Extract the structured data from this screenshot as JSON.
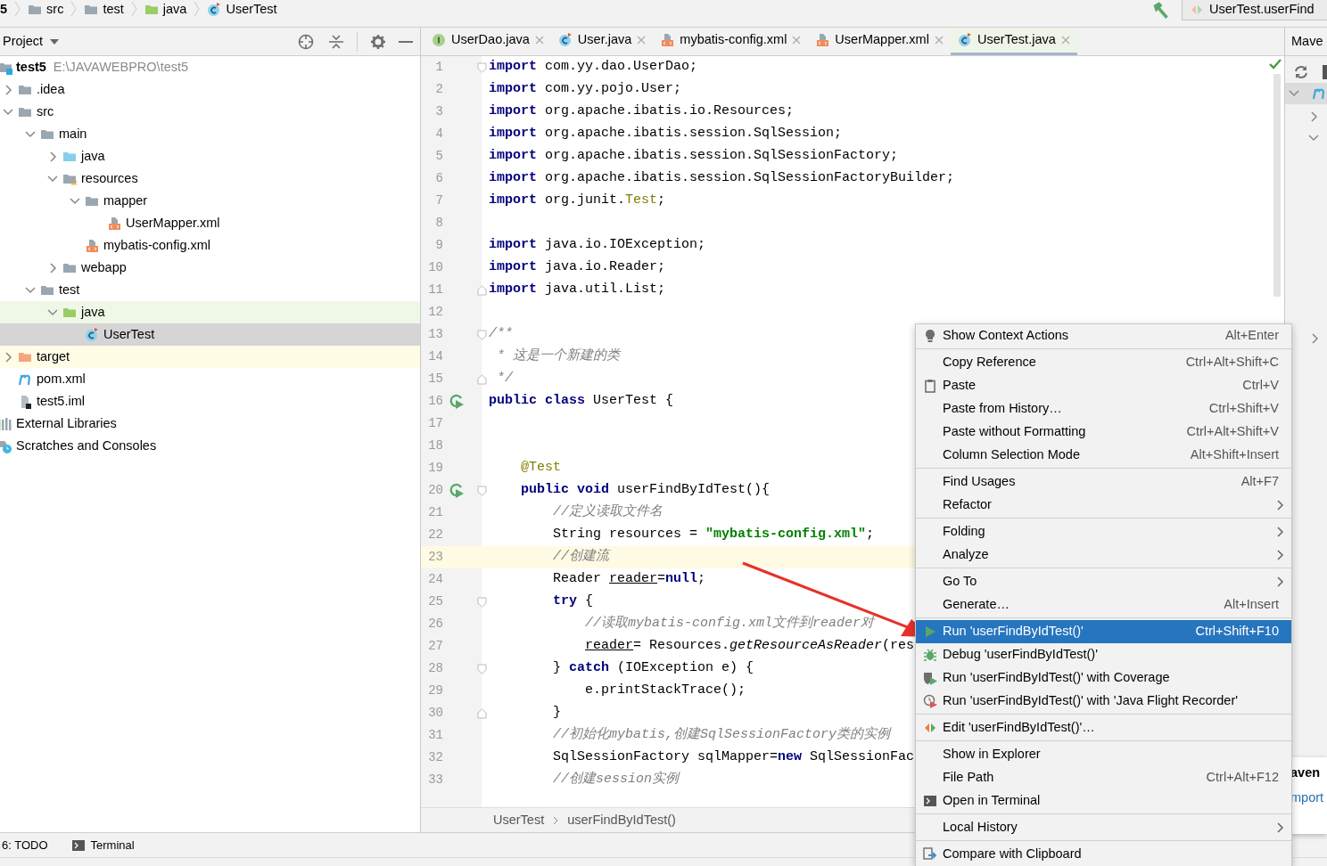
{
  "breadcrumb": [
    {
      "label": "5"
    },
    {
      "label": "src",
      "kind": "folder"
    },
    {
      "label": "test",
      "kind": "folder"
    },
    {
      "label": "java",
      "kind": "test-folder"
    },
    {
      "label": "UserTest",
      "kind": "class"
    }
  ],
  "run_config": {
    "label": "UserTest.userFind"
  },
  "project_panel": {
    "title": "Project",
    "tree": [
      {
        "label": "test5",
        "path": "E:\\JAVAWEBPRO\\test5",
        "kind": "module",
        "expanded": true,
        "selected": false,
        "children": [
          {
            "label": ".idea",
            "kind": "folder",
            "expanded": false,
            "selected": false
          },
          {
            "label": "src",
            "kind": "folder",
            "expanded": true,
            "selected": false,
            "children": [
              {
                "label": "main",
                "kind": "folder",
                "expanded": true,
                "selected": false,
                "children": [
                  {
                    "label": "java",
                    "kind": "src-folder",
                    "expanded": false,
                    "selected": false
                  },
                  {
                    "label": "resources",
                    "kind": "res-folder",
                    "expanded": true,
                    "selected": false,
                    "children": [
                      {
                        "label": "mapper",
                        "kind": "folder",
                        "expanded": true,
                        "selected": false,
                        "children": [
                          {
                            "label": "UserMapper.xml",
                            "kind": "xml",
                            "selected": false
                          }
                        ]
                      },
                      {
                        "label": "mybatis-config.xml",
                        "kind": "xml",
                        "selected": false
                      }
                    ]
                  },
                  {
                    "label": "webapp",
                    "kind": "folder",
                    "expanded": false,
                    "selected": false
                  }
                ]
              },
              {
                "label": "test",
                "kind": "folder",
                "expanded": true,
                "selected": false,
                "children": [
                  {
                    "label": "java",
                    "kind": "test-folder",
                    "expanded": true,
                    "selected": false,
                    "color": "#eff8e6",
                    "children": [
                      {
                        "label": "UserTest",
                        "kind": "class",
                        "selected": true
                      }
                    ]
                  }
                ]
              }
            ]
          },
          {
            "label": "target",
            "kind": "excluded-folder",
            "expanded": false,
            "selected": false,
            "color": "#fffde6"
          },
          {
            "label": "pom.xml",
            "kind": "maven",
            "selected": false
          },
          {
            "label": "test5.iml",
            "kind": "iml",
            "selected": false
          }
        ]
      },
      {
        "label": "External Libraries",
        "kind": "libs",
        "selected": false
      },
      {
        "label": "Scratches and Consoles",
        "kind": "scratch",
        "selected": false
      }
    ]
  },
  "tabs": [
    {
      "label": "UserDao.java",
      "kind": "interface",
      "selected": false
    },
    {
      "label": "User.java",
      "kind": "class",
      "selected": false
    },
    {
      "label": "mybatis-config.xml",
      "kind": "xml",
      "selected": false
    },
    {
      "label": "UserMapper.xml",
      "kind": "xml",
      "selected": false
    },
    {
      "label": "UserTest.java",
      "kind": "class",
      "selected": true
    }
  ],
  "editor": {
    "lines": [
      {
        "number": "1",
        "current": false,
        "run_marker": false,
        "fold_start": true,
        "fold_end": false,
        "tokens": [
          {
            "kind": "kw",
            "text": "import"
          },
          {
            "kind": "plain",
            "text": " com.yy.dao.UserDao;"
          }
        ]
      },
      {
        "number": "2",
        "current": false,
        "run_marker": false,
        "fold_start": false,
        "fold_end": false,
        "tokens": [
          {
            "kind": "kw",
            "text": "import"
          },
          {
            "kind": "plain",
            "text": " com.yy.pojo.User;"
          }
        ]
      },
      {
        "number": "3",
        "current": false,
        "run_marker": false,
        "fold_start": false,
        "fold_end": false,
        "tokens": [
          {
            "kind": "kw",
            "text": "import"
          },
          {
            "kind": "plain",
            "text": " org.apache.ibatis.io.Resources;"
          }
        ]
      },
      {
        "number": "4",
        "current": false,
        "run_marker": false,
        "fold_start": false,
        "fold_end": false,
        "tokens": [
          {
            "kind": "kw",
            "text": "import"
          },
          {
            "kind": "plain",
            "text": " org.apache.ibatis.session.SqlSession;"
          }
        ]
      },
      {
        "number": "5",
        "current": false,
        "run_marker": false,
        "fold_start": false,
        "fold_end": false,
        "tokens": [
          {
            "kind": "kw",
            "text": "import"
          },
          {
            "kind": "plain",
            "text": " org.apache.ibatis.session.SqlSessionFactory;"
          }
        ]
      },
      {
        "number": "6",
        "current": false,
        "run_marker": false,
        "fold_start": false,
        "fold_end": false,
        "tokens": [
          {
            "kind": "kw",
            "text": "import"
          },
          {
            "kind": "plain",
            "text": " org.apache.ibatis.session.SqlSessionFactoryBuilder;"
          }
        ]
      },
      {
        "number": "7",
        "current": false,
        "run_marker": false,
        "fold_start": false,
        "fold_end": false,
        "tokens": [
          {
            "kind": "kw",
            "text": "import"
          },
          {
            "kind": "plain",
            "text": " org.junit."
          },
          {
            "kind": "annot",
            "text": "Test"
          },
          {
            "kind": "plain",
            "text": ";"
          }
        ]
      },
      {
        "number": "8",
        "current": false,
        "run_marker": false,
        "fold_start": false,
        "fold_end": false
      },
      {
        "number": "9",
        "current": false,
        "run_marker": false,
        "fold_start": false,
        "fold_end": false,
        "tokens": [
          {
            "kind": "kw",
            "text": "import"
          },
          {
            "kind": "plain",
            "text": " java.io.IOException;"
          }
        ]
      },
      {
        "number": "10",
        "current": false,
        "run_marker": false,
        "fold_start": false,
        "fold_end": false,
        "tokens": [
          {
            "kind": "kw",
            "text": "import"
          },
          {
            "kind": "plain",
            "text": " java.io.Reader;"
          }
        ]
      },
      {
        "number": "11",
        "current": false,
        "run_marker": false,
        "fold_start": false,
        "fold_end": true,
        "tokens": [
          {
            "kind": "kw",
            "text": "import"
          },
          {
            "kind": "plain",
            "text": " java.util.List;"
          }
        ]
      },
      {
        "number": "12",
        "current": false,
        "run_marker": false,
        "fold_start": false,
        "fold_end": false
      },
      {
        "number": "13",
        "current": false,
        "run_marker": false,
        "fold_start": true,
        "fold_end": false,
        "tokens": [
          {
            "kind": "comment",
            "text": "/**"
          }
        ]
      },
      {
        "number": "14",
        "current": false,
        "run_marker": false,
        "fold_start": false,
        "fold_end": false,
        "tokens": [
          {
            "kind": "comment",
            "text": " * 这是一个新建的类"
          }
        ]
      },
      {
        "number": "15",
        "current": false,
        "run_marker": false,
        "fold_start": false,
        "fold_end": true,
        "tokens": [
          {
            "kind": "comment",
            "text": " */"
          }
        ]
      },
      {
        "number": "16",
        "current": false,
        "run_marker": true,
        "fold_start": false,
        "fold_end": false,
        "tokens": [
          {
            "kind": "kw",
            "text": "public class"
          },
          {
            "kind": "plain",
            "text": " UserTest {"
          }
        ]
      },
      {
        "number": "17",
        "current": false,
        "run_marker": false,
        "fold_start": false,
        "fold_end": false
      },
      {
        "number": "18",
        "current": false,
        "run_marker": false,
        "fold_start": false,
        "fold_end": false
      },
      {
        "number": "19",
        "current": false,
        "run_marker": false,
        "fold_start": false,
        "fold_end": false,
        "tokens": [
          {
            "kind": "annot",
            "text": "    @Test"
          }
        ]
      },
      {
        "number": "20",
        "current": false,
        "run_marker": true,
        "fold_start": true,
        "fold_end": false,
        "tokens": [
          {
            "kind": "kw",
            "text": "    public void"
          },
          {
            "kind": "plain",
            "text": " userFindByIdTest(){"
          }
        ]
      },
      {
        "number": "21",
        "current": false,
        "run_marker": false,
        "fold_start": false,
        "fold_end": false,
        "tokens": [
          {
            "kind": "comment",
            "text": "        //定义读取文件名"
          }
        ]
      },
      {
        "number": "22",
        "current": false,
        "run_marker": false,
        "fold_start": false,
        "fold_end": false,
        "tokens": [
          {
            "kind": "plain",
            "text": "        String resources = "
          },
          {
            "kind": "str",
            "text": "\"mybatis-config.xml\""
          },
          {
            "kind": "plain",
            "text": ";"
          }
        ]
      },
      {
        "number": "23",
        "current": true,
        "run_marker": false,
        "fold_start": false,
        "fold_end": false,
        "tokens": [
          {
            "kind": "comment",
            "text": "        //创建流"
          }
        ]
      },
      {
        "number": "24",
        "current": false,
        "run_marker": false,
        "fold_start": false,
        "fold_end": false,
        "tokens": [
          {
            "kind": "plain",
            "text": "        Reader "
          },
          {
            "kind": "var",
            "text": "reader"
          },
          {
            "kind": "plain",
            "text": "="
          },
          {
            "kind": "kw",
            "text": "null"
          },
          {
            "kind": "plain",
            "text": ";"
          }
        ]
      },
      {
        "number": "25",
        "current": false,
        "run_marker": false,
        "fold_start": true,
        "fold_end": false,
        "tokens": [
          {
            "kind": "kw",
            "text": "        try"
          },
          {
            "kind": "plain",
            "text": " {"
          }
        ]
      },
      {
        "number": "26",
        "current": false,
        "run_marker": false,
        "fold_start": false,
        "fold_end": false,
        "tokens": [
          {
            "kind": "comment",
            "text": "            //读取mybatis-config.xml文件到reader对"
          }
        ]
      },
      {
        "number": "27",
        "current": false,
        "run_marker": false,
        "fold_start": false,
        "fold_end": false,
        "tokens": [
          {
            "kind": "var",
            "text": "            reader"
          },
          {
            "kind": "plain",
            "text": "= Resources."
          },
          {
            "kind": "italic",
            "text": "getResourceAsReader"
          },
          {
            "kind": "plain",
            "text": "(res"
          }
        ]
      },
      {
        "number": "28",
        "current": false,
        "run_marker": false,
        "fold_start": true,
        "fold_end": false,
        "tokens": [
          {
            "kind": "plain",
            "text": "        } "
          },
          {
            "kind": "kw",
            "text": "catch"
          },
          {
            "kind": "plain",
            "text": " (IOException e) {"
          }
        ]
      },
      {
        "number": "29",
        "current": false,
        "run_marker": false,
        "fold_start": false,
        "fold_end": false,
        "tokens": [
          {
            "kind": "plain",
            "text": "            e.printStackTrace();"
          }
        ]
      },
      {
        "number": "30",
        "current": false,
        "run_marker": false,
        "fold_start": false,
        "fold_end": true,
        "tokens": [
          {
            "kind": "plain",
            "text": "        }"
          }
        ]
      },
      {
        "number": "31",
        "current": false,
        "run_marker": false,
        "fold_start": false,
        "fold_end": false,
        "tokens": [
          {
            "kind": "comment",
            "text": "        //初始化mybatis,创建SqlSessionFactory类的实例"
          }
        ]
      },
      {
        "number": "32",
        "current": false,
        "run_marker": false,
        "fold_start": false,
        "fold_end": false,
        "tokens": [
          {
            "kind": "plain",
            "text": "        SqlSessionFactory sqlMapper="
          },
          {
            "kind": "kw",
            "text": "new"
          },
          {
            "kind": "plain",
            "text": " SqlSessionFac"
          }
        ]
      },
      {
        "number": "33",
        "current": false,
        "run_marker": false,
        "fold_start": false,
        "fold_end": false,
        "tokens": [
          {
            "kind": "comment",
            "text": "        //创建session实例"
          }
        ]
      }
    ],
    "breadcrumb": [
      "UserTest",
      "userFindByIdTest()"
    ]
  },
  "maven_panel": {
    "title": "Mave",
    "notification": {
      "title": "aven",
      "link": "mport"
    }
  },
  "bottom_toolbar": [
    {
      "label": "6: TODO"
    },
    {
      "label": "Terminal",
      "kind": "terminal"
    }
  ],
  "context_menu": {
    "groups": [
      [
        {
          "label": "Show Context Actions",
          "shortcut": "Alt+Enter",
          "kind": "bulb",
          "selected": false
        }
      ],
      [
        {
          "label": "Copy Reference",
          "shortcut": "Ctrl+Alt+Shift+C",
          "selected": false
        },
        {
          "label": "Paste",
          "shortcut": "Ctrl+V",
          "kind": "clipboard",
          "selected": false
        },
        {
          "label": "Paste from History…",
          "shortcut": "Ctrl+Shift+V",
          "selected": false
        },
        {
          "label": "Paste without Formatting",
          "shortcut": "Ctrl+Alt+Shift+V",
          "selected": false
        },
        {
          "label": "Column Selection Mode",
          "shortcut": "Alt+Shift+Insert",
          "selected": false
        }
      ],
      [
        {
          "label": "Find Usages",
          "shortcut": "Alt+F7",
          "selected": false
        },
        {
          "label": "Refactor",
          "submenu": true,
          "selected": false
        }
      ],
      [
        {
          "label": "Folding",
          "submenu": true,
          "selected": false
        },
        {
          "label": "Analyze",
          "submenu": true,
          "selected": false
        }
      ],
      [
        {
          "label": "Go To",
          "submenu": true,
          "selected": false
        },
        {
          "label": "Generate…",
          "shortcut": "Alt+Insert",
          "selected": false
        }
      ],
      [
        {
          "label": "Run 'userFindByIdTest()'",
          "shortcut": "Ctrl+Shift+F10",
          "kind": "run",
          "selected": true
        },
        {
          "label": "Debug 'userFindByIdTest()'",
          "kind": "debug",
          "selected": false
        },
        {
          "label": "Run 'userFindByIdTest()' with Coverage",
          "kind": "coverage",
          "selected": false
        },
        {
          "label": "Run 'userFindByIdTest()' with 'Java Flight Recorder'",
          "kind": "profiler",
          "selected": false
        }
      ],
      [
        {
          "label": "Edit 'userFindByIdTest()'…",
          "kind": "edit-config",
          "selected": false
        }
      ],
      [
        {
          "label": "Show in Explorer",
          "selected": false
        },
        {
          "label": "File Path",
          "shortcut": "Ctrl+Alt+F12",
          "selected": false
        },
        {
          "label": "Open in Terminal",
          "kind": "terminal",
          "selected": false
        }
      ],
      [
        {
          "label": "Local History",
          "submenu": true,
          "selected": false
        }
      ],
      [
        {
          "label": "Compare with Clipboard",
          "kind": "compare",
          "selected": false
        }
      ]
    ]
  }
}
